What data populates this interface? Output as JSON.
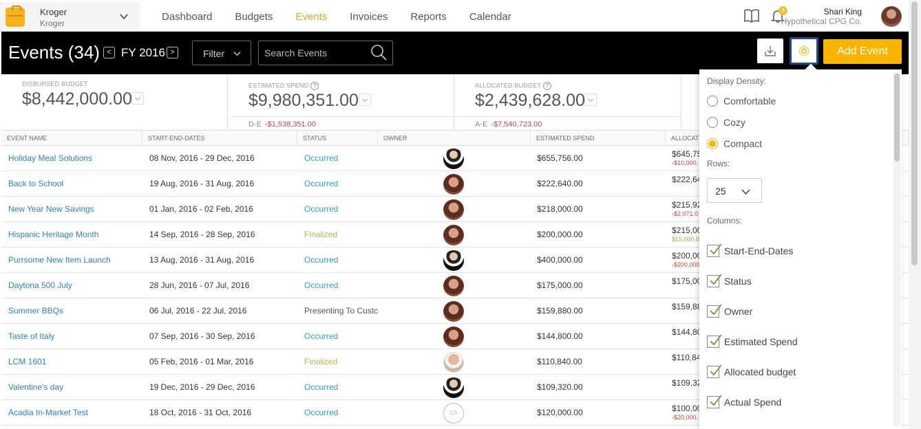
{
  "account": {
    "name": "Kroger",
    "sub": "Kroger"
  },
  "nav": [
    "Dashboard",
    "Budgets",
    "Events",
    "Invoices",
    "Reports",
    "Calendar"
  ],
  "nav_active": "Events",
  "notifications": {
    "count": "3"
  },
  "user": {
    "name": "Shari King",
    "company": "Hypothetical CPG Co."
  },
  "header": {
    "title": "Events (34)",
    "fy": "FY 2016",
    "filter_label": "Filter",
    "search_placeholder": "Search Events",
    "add_label": "Add Event"
  },
  "summary": {
    "disbursed": {
      "label": "Disbursed Budget",
      "value": "$8,442,000.00"
    },
    "estimated": {
      "label": "Estimated Spend",
      "value": "$9,980,351.00",
      "foot_label": "D-E",
      "foot_value": "-$1,538,351.00"
    },
    "allocated": {
      "label": "Allocated Budget",
      "value": "$2,439,628.00",
      "foot_label": "A-E",
      "foot_value": "-$7,540,723.00"
    }
  },
  "columns": [
    "Event Name",
    "Start-End-Dates",
    "Status",
    "Owner",
    "Estimated Spend",
    "Allocat"
  ],
  "events": [
    {
      "name": "Holiday Meal Solutions",
      "dates": "08 Nov, 2016 - 29 Dec, 2016",
      "status": "Occurred",
      "owner": "man",
      "spend": "$655,756.00",
      "alloc": "$645,75",
      "alloc_diff": "-$10,000."
    },
    {
      "name": "Back to School",
      "dates": "19 Aug, 2016 - 31 Aug, 2016",
      "status": "Occurred",
      "owner": "woman",
      "spend": "$222,640.00",
      "alloc": "$222,64",
      "alloc_diff": ""
    },
    {
      "name": "New Year New Savings",
      "dates": "01 Jan, 2016 - 02 Feb, 2016",
      "status": "Occurred",
      "owner": "woman",
      "spend": "$218,000.00",
      "alloc": "$215,92",
      "alloc_diff": "-$2,071.0"
    },
    {
      "name": "Hispanic Heritage Month",
      "dates": "14 Sep, 2016 - 28 Sep, 2016",
      "status": "Finalized",
      "owner": "woman",
      "spend": "$200,000.00",
      "alloc": "$215,00",
      "alloc_diff": "$15,000.0"
    },
    {
      "name": "Purrsome New Item Launch",
      "dates": "13 Aug, 2016 - 31 Aug, 2016",
      "status": "Occurred",
      "owner": "man",
      "spend": "$400,000.00",
      "alloc": "$200,00",
      "alloc_diff": "-$200,000"
    },
    {
      "name": "Daytona 500 July",
      "dates": "28 Jun, 2016 - 07 Jul, 2016",
      "status": "Occurred",
      "owner": "woman",
      "spend": "$175,000.00",
      "alloc": "$175,00",
      "alloc_diff": ""
    },
    {
      "name": "Summer BBQs",
      "dates": "06 Jul, 2016 - 22 Jul, 2016",
      "status": "Presenting To Custc",
      "owner": "woman",
      "spend": "$159,880.00",
      "alloc": "$159,88",
      "alloc_diff": ""
    },
    {
      "name": "Taste of Italy",
      "dates": "07 Sep, 2016 - 30 Sep, 2016",
      "status": "Occurred",
      "owner": "woman",
      "spend": "$144,800.00",
      "alloc": "$144,80",
      "alloc_diff": ""
    },
    {
      "name": "LCM 1601",
      "dates": "05 Feb, 2016 - 01 Mar, 2016",
      "status": "Finalized",
      "owner": "bald",
      "spend": "$110,840.00",
      "alloc": "$110,84",
      "alloc_diff": ""
    },
    {
      "name": "Valentine's day",
      "dates": "19 Dec, 2016 - 29 Dec, 2016",
      "status": "Occurred",
      "owner": "man",
      "spend": "$109,320.00",
      "alloc": "$109,32",
      "alloc_diff": ""
    },
    {
      "name": "Acadia In-Market Test",
      "dates": "18 Oct, 2016 - 31 Oct, 2016",
      "status": "Occurred",
      "owner": "CA",
      "spend": "$120,000.00",
      "alloc": "$100,00",
      "alloc_diff": "-$20,000."
    }
  ],
  "settings": {
    "density_label": "Display Density:",
    "density_options": [
      "Comfortable",
      "Cozy",
      "Compact"
    ],
    "density_selected": "Compact",
    "rows_label": "Rows:",
    "rows_value": "25",
    "columns_label": "Columns:",
    "column_options": [
      "Start-End-Dates",
      "Status",
      "Owner",
      "Estimated Spend",
      "Allocated budget",
      "Actual Spend"
    ]
  },
  "colors": {
    "accent": "#f8b400",
    "link": "#2f7fc1",
    "negative": "#d04040"
  }
}
